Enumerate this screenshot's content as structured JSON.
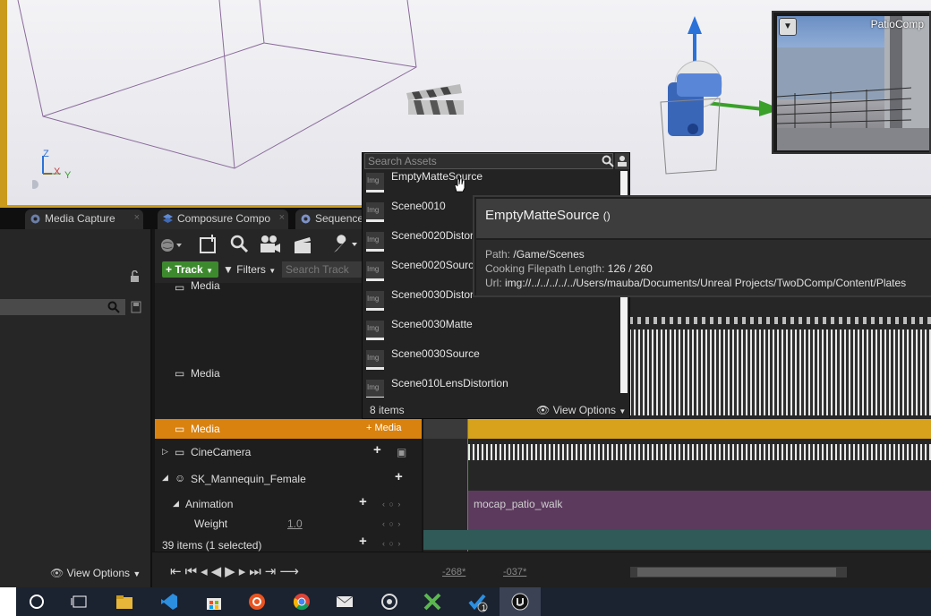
{
  "viewport": {
    "pip_title": "PatioComp",
    "axis_labels": {
      "z": "Z",
      "x": "X",
      "y": "Y"
    }
  },
  "tabs": [
    {
      "label": "Media Capture",
      "close": "×"
    },
    {
      "label": "Composure Compo",
      "close": "×"
    },
    {
      "label": "Sequence",
      "close": ""
    }
  ],
  "left_panel": {
    "view_options": "View Options"
  },
  "sequencer": {
    "track_button": "Track",
    "filters_button": "Filters",
    "search_placeholder": "Search Track",
    "items_status": "39 items (1 selected)"
  },
  "outliner_rows": [
    {
      "label": "Media"
    },
    {
      "label": "Media"
    },
    {
      "label": "Media",
      "add": "+ Media"
    },
    {
      "label": "CineCamera"
    },
    {
      "label": "SK_Mannequin_Female"
    },
    {
      "label": "Animation"
    },
    {
      "label": "Weight",
      "value": "1.0"
    }
  ],
  "timeline": {
    "section_label": "mocap_patio_walk",
    "frame_start": "-268*",
    "frame_end": "-037*"
  },
  "asset_picker": {
    "search_placeholder": "Search Assets",
    "thumb_text": "Img",
    "items": [
      "EmptyMatteSource",
      "Scene0010",
      "Scene0020Distor",
      "Scene0020Source",
      "Scene0030Distor",
      "Scene0030Matte",
      "Scene0030Source",
      "Scene010LensDistortion"
    ],
    "count": "8 items",
    "view_options": "View Options"
  },
  "tooltip": {
    "title": "EmptyMatteSource",
    "title_suffix": "()",
    "path_label": "Path:",
    "path_value": "/Game/Scenes",
    "cooking_label": "Cooking Filepath Length:",
    "cooking_value": "126 / 260",
    "url_label": "Url:",
    "url_value": "img://../../../../../Users/mauba/Documents/Unreal Projects/TwoDComp/Content/Plates"
  },
  "taskbar_icons": [
    "cortana-icon",
    "task-view-icon",
    "file-explorer-icon",
    "vscode-icon",
    "store-icon",
    "ubuntu-icon",
    "chrome-icon",
    "mail-icon",
    "blender-icon",
    "xmind-icon",
    "todo-icon",
    "unreal-icon"
  ],
  "taskbar_badge": "1"
}
